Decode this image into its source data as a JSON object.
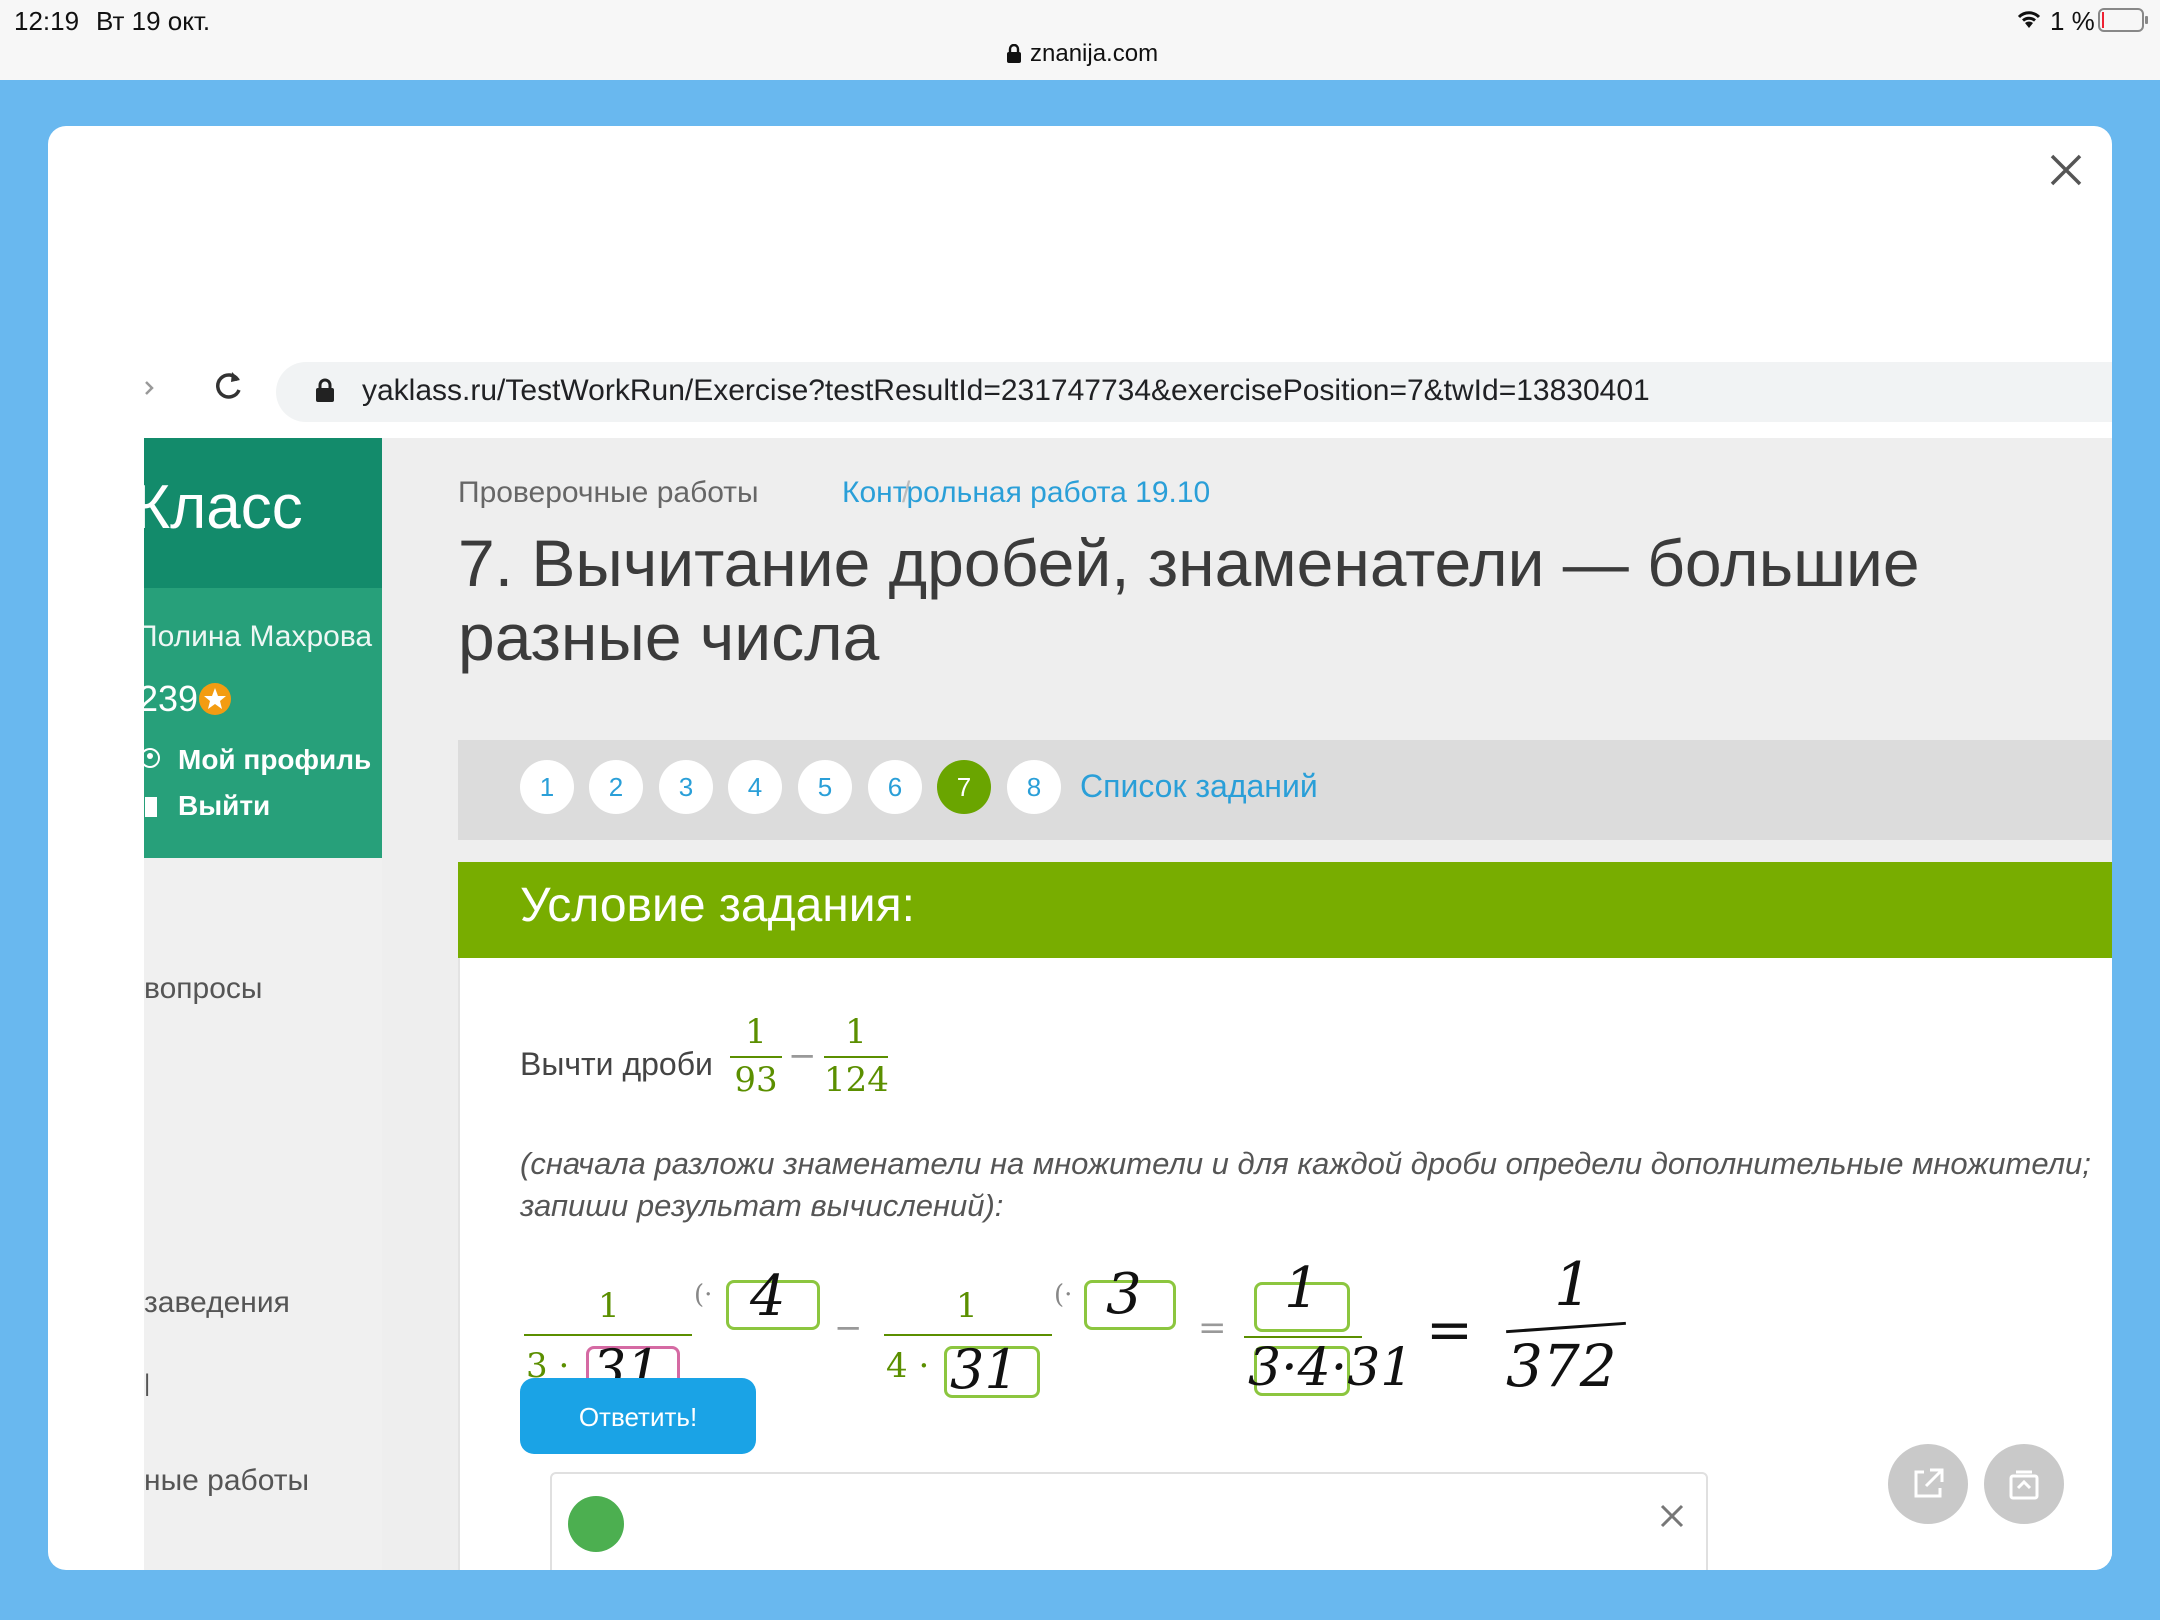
{
  "status_bar": {
    "time": "12:19",
    "date": "Вт 19 окт.",
    "battery": "1 %",
    "address": "znanija.com"
  },
  "background_page": {
    "bottom_left": "",
    "bottom_right": ""
  },
  "modal": {
    "browser": {
      "url": "yaklass.ru/TestWorkRun/Exercise?testResultId=231747734&exercisePosition=7&twId=13830401"
    },
    "sidebar": {
      "logo": "Класс",
      "user_name": "Полина Махрова",
      "points": "239",
      "profile_link": "Мой профиль",
      "logout_link": "Выйти",
      "menu_items": [
        "вопросы",
        "заведения",
        "ные работы",
        "Я+"
      ]
    },
    "breadcrumb": {
      "root": "Проверочные работы",
      "separator": "/",
      "current": "Контрольная работа 19.10"
    },
    "title": "7. Вычитание дробей, знаменатели — большие разные числа",
    "pager": {
      "pages": [
        "1",
        "2",
        "3",
        "4",
        "5",
        "6",
        "7",
        "8"
      ],
      "active_page": "7",
      "list_link": "Список заданий"
    },
    "task": {
      "header": "Условие задания:",
      "prompt": "Вычти дроби",
      "fraction1": {
        "num": "1",
        "den": "93"
      },
      "minus": "−",
      "fraction2": {
        "num": "1",
        "den": "124"
      },
      "instruction_line1": "(сначала разложи знаменатели на множители и для каждой дроби определи дополнительные множители;",
      "instruction_line2": "запиши результат вычислений):",
      "equation": {
        "left_num": "1",
        "left_den_factor": "3 ·",
        "left_den_input": "31",
        "left_mult_prefix": "(·",
        "left_mult_input": "4",
        "minus": "−",
        "right_num": "1",
        "right_den_factor": "4 ·",
        "right_den_input": "31",
        "right_mult_prefix": "(·",
        "right_mult_input": "3",
        "equals": "=",
        "result_num_input": "1",
        "result_den_handwritten": "3·4·31",
        "equals2": "=",
        "final_num": "1",
        "final_den": "372"
      },
      "answer_button": "Ответить!"
    }
  },
  "colors": {
    "accent_green": "#78ad00",
    "sidebar_green": "#27a07a",
    "link_blue": "#2a9fd8",
    "button_blue": "#1aa3e6",
    "page_blue": "#69b8ef"
  },
  "icons": [
    "lock-icon",
    "wifi-icon",
    "battery-icon",
    "close-icon",
    "back-arrow-icon",
    "reload-icon",
    "star-icon",
    "user-icon",
    "door-icon",
    "share-icon",
    "save-icon"
  ]
}
